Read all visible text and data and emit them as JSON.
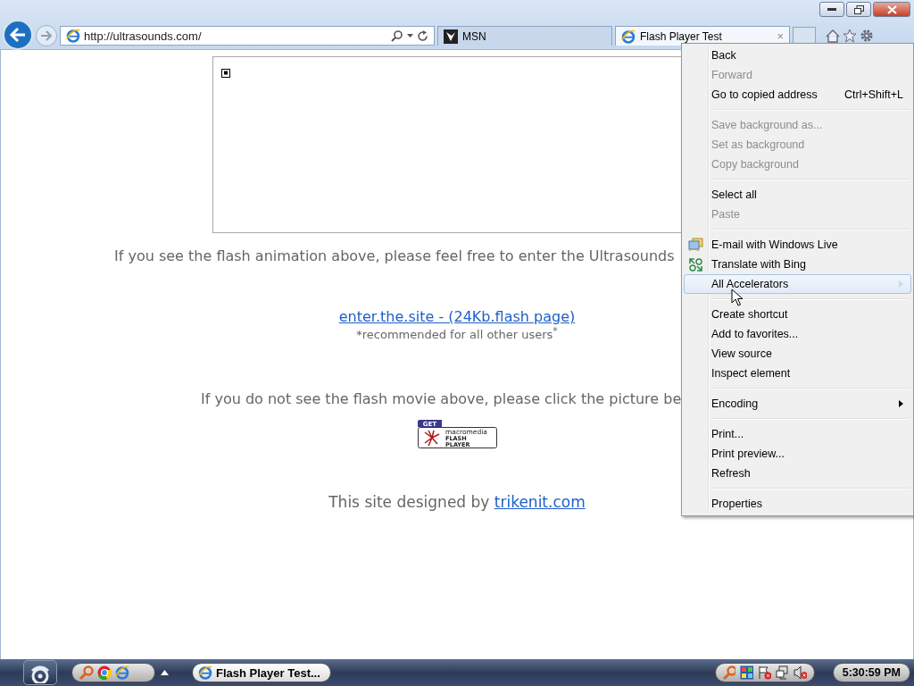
{
  "toolbar": {
    "address": "http://ultrasounds.com/",
    "tabs": [
      {
        "label": "MSN",
        "selected": false
      },
      {
        "label": "Flash Player Test",
        "selected": true,
        "close_glyph": "×"
      }
    ]
  },
  "page": {
    "intro": "If you see the flash animation above, please feel free to enter the Ultrasounds",
    "link": "enter.the.site - (24Kb.flash page)",
    "note": "*recommended for all other users",
    "note_mark": "*",
    "fallback": "If you do not see the flash movie above, please click the picture be",
    "badge": {
      "tag": "GET",
      "lines": [
        "macromedia",
        "FLASH",
        "PLAYER"
      ]
    },
    "credit": "This site designed by",
    "credit_link": "trikenit.com"
  },
  "context_menu": {
    "items": [
      {
        "kind": "item",
        "label": "Back",
        "disabled": false,
        "selected": false,
        "submenu": false
      },
      {
        "kind": "item",
        "label": "Forward",
        "disabled": true,
        "selected": false,
        "submenu": false
      },
      {
        "kind": "item",
        "label": "Go to copied address",
        "shortcut": "Ctrl+Shift+L",
        "disabled": false,
        "selected": false,
        "submenu": false
      },
      {
        "kind": "separator"
      },
      {
        "kind": "item",
        "label": "Save background as...",
        "disabled": true,
        "selected": false,
        "submenu": false
      },
      {
        "kind": "item",
        "label": "Set as background",
        "disabled": true,
        "selected": false,
        "submenu": false
      },
      {
        "kind": "item",
        "label": "Copy background",
        "disabled": true,
        "selected": false,
        "submenu": false
      },
      {
        "kind": "separator"
      },
      {
        "kind": "item",
        "label": "Select all",
        "disabled": false,
        "selected": false,
        "submenu": false
      },
      {
        "kind": "item",
        "label": "Paste",
        "disabled": true,
        "selected": false,
        "submenu": false
      },
      {
        "kind": "separator"
      },
      {
        "kind": "accelerator",
        "label": "E-mail with Windows Live",
        "disabled": false,
        "selected": false,
        "submenu": false
      },
      {
        "kind": "accelerator",
        "label": "Translate with Bing",
        "disabled": false,
        "selected": false,
        "submenu": false
      },
      {
        "kind": "item",
        "label": "All Accelerators",
        "disabled": false,
        "selected": true,
        "submenu": true
      },
      {
        "kind": "separator"
      },
      {
        "kind": "item",
        "label": "Create shortcut",
        "disabled": false,
        "selected": false,
        "submenu": false
      },
      {
        "kind": "item",
        "label": "Add to favorites...",
        "disabled": false,
        "selected": false,
        "submenu": false
      },
      {
        "kind": "item",
        "label": "View source",
        "disabled": false,
        "selected": false,
        "submenu": false
      },
      {
        "kind": "item",
        "label": "Inspect element",
        "disabled": false,
        "selected": false,
        "submenu": false
      },
      {
        "kind": "separator"
      },
      {
        "kind": "item",
        "label": "Encoding",
        "disabled": false,
        "selected": false,
        "submenu": true
      },
      {
        "kind": "separator"
      },
      {
        "kind": "item",
        "label": "Print...",
        "disabled": false,
        "selected": false,
        "submenu": false
      },
      {
        "kind": "item",
        "label": "Print preview...",
        "disabled": false,
        "selected": false,
        "submenu": false
      },
      {
        "kind": "item",
        "label": "Refresh",
        "disabled": false,
        "selected": false,
        "submenu": false
      },
      {
        "kind": "separator"
      },
      {
        "kind": "item",
        "label": "Properties",
        "disabled": false,
        "selected": false,
        "submenu": false
      }
    ]
  },
  "taskbar": {
    "tasks": [
      {
        "label": "Flash Player Test...",
        "selected": false
      }
    ],
    "clock": "5:30:59 PM"
  }
}
